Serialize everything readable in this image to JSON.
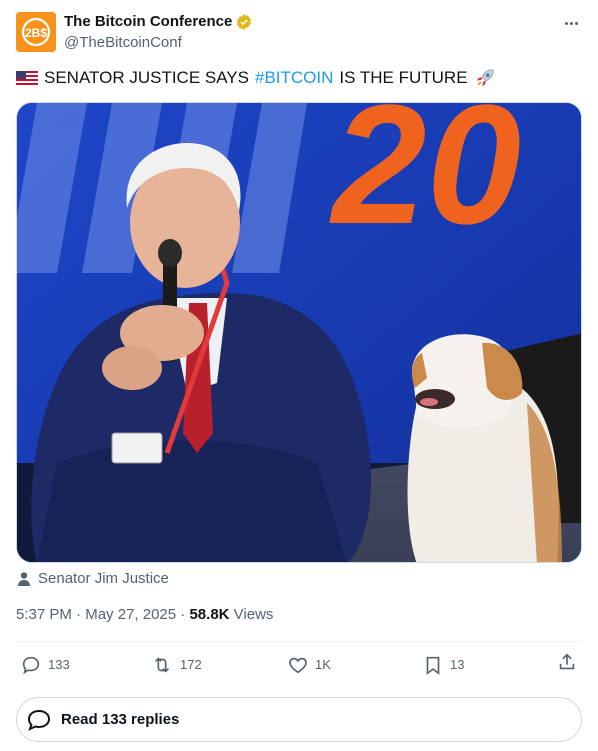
{
  "account": {
    "display_name": "The Bitcoin Conference",
    "handle": "@TheBitcoinConf",
    "avatar_text": "2B$",
    "verified_color": "#e2b719"
  },
  "tweet": {
    "flag_icon": "us-flag-icon",
    "text_before": "SENATOR JUSTICE SAYS",
    "hashtag": "#BITCOIN",
    "text_after": "IS THE FUTURE",
    "rocket_icon": "rocket-icon",
    "hashtag_color": "#1d9bf0"
  },
  "media": {
    "backdrop_text": "20"
  },
  "tagged_person": "Senator Jim Justice",
  "meta": {
    "time": "5:37 PM",
    "separator": "·",
    "date": "May 27, 2025",
    "views_count": "58.8K",
    "views_label": "Views"
  },
  "actions": {
    "replies": "133",
    "reposts": "172",
    "likes": "1K",
    "bookmarks": "13"
  },
  "read_replies_label": "Read 133 replies"
}
